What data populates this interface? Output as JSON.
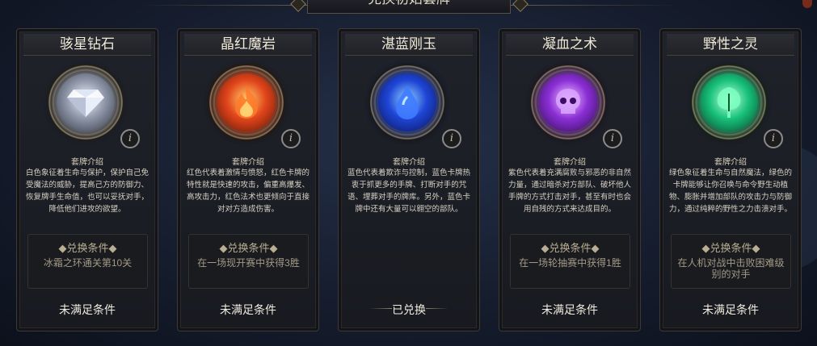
{
  "header": {
    "title": "兑换初始套牌"
  },
  "intro_heading": "套牌介绍",
  "condition_heading": "◆兑换条件◆",
  "cards": [
    {
      "name": "骇星钻石",
      "orb_icon": "diamond-icon",
      "colors": {
        "core": "#f4f6ff",
        "mid": "#8e96a8",
        "edge": "#2e3340"
      },
      "description": "白色象征着生命与保护，保护自己免受魔法的威胁，提高己方的防御力、恢复牌手生命值，也可以妥抚对手，降低他们进攻的欲望。",
      "condition": "冰霜之环通关第10关",
      "status": "未满足条件"
    },
    {
      "name": "晶红魔岩",
      "orb_icon": "fire-icon",
      "colors": {
        "core": "#ffcf6a",
        "mid": "#e2461b",
        "edge": "#5a1206"
      },
      "description": "红色代表着激情与愤怒，红色卡牌的特性就是快速的攻击，偏重高爆发、高攻击力，红色法术也更倾向于直接对对方造成伤害。",
      "condition": "在一场现开赛中获得3胜",
      "status": "未满足条件"
    },
    {
      "name": "湛蓝刚玉",
      "orb_icon": "water-drop-icon",
      "colors": {
        "core": "#8fd3ff",
        "mid": "#1e45d6",
        "edge": "#0a1252"
      },
      "description": "蓝色代表着欺诈与控制，蓝色卡牌热衷于抓更多的手牌、打断对手的咒语、埋葬对手的牌库。另外，蓝色卡牌中还有大量可以翱空的部队。",
      "condition": "",
      "status": "已兑换"
    },
    {
      "name": "凝血之术",
      "orb_icon": "skull-icon",
      "colors": {
        "core": "#f2c8ff",
        "mid": "#8b2fd6",
        "edge": "#2c0b4e"
      },
      "description": "紫色代表着充满腐败与邪恶的非自然力量，通过暗杀对方部队、破坏他人手牌的方式打击对手，甚至有时也会用自残的方式来达成目的。",
      "condition": "在一场轮抽赛中获得1胜",
      "status": "未满足条件"
    },
    {
      "name": "野性之灵",
      "orb_icon": "tree-icon",
      "colors": {
        "core": "#c8ffe0",
        "mid": "#18c27a",
        "edge": "#06402a"
      },
      "description": "绿色象征着生命与自然魔法，绿色的卡牌能够让你召唤与命令野生动植物、膨胀并增加部队的攻击力与防御力，通过纯粹的野性之力击溃对手。",
      "condition": "在人机对战中击败困难级别的对手",
      "status": "未满足条件"
    }
  ]
}
